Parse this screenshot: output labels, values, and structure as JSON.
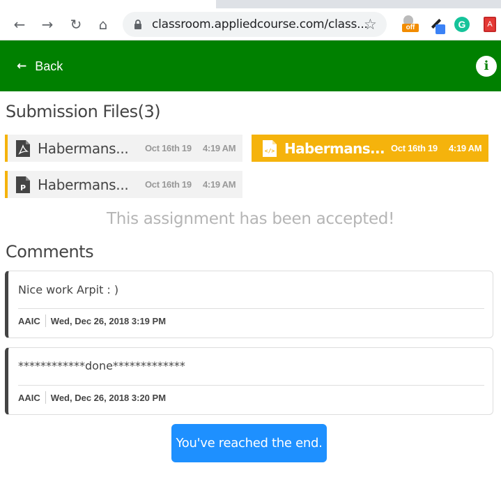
{
  "browser": {
    "url": "classroom.appliedcourse.com/class...",
    "nav": {
      "back_icon": "←",
      "forward_icon": "→",
      "reload_icon": "↻",
      "home_icon": "⌂",
      "star_icon": "☆"
    },
    "extensions": [
      {
        "name": "off-extension",
        "badge": "off"
      },
      {
        "name": "color-picker-extension"
      },
      {
        "name": "grammarly-extension",
        "letter": "G"
      },
      {
        "name": "red-extension",
        "letter": "A"
      }
    ]
  },
  "header": {
    "back_label": "Back",
    "back_icon": "←",
    "info_icon": "i",
    "bg_color": "#008000"
  },
  "submission": {
    "title": "Submission Files(3)",
    "files": [
      {
        "name": "Habermans...",
        "date": "Oct 16th 19",
        "time": "4:19 AM",
        "icon": "pdf-icon",
        "active": false
      },
      {
        "name": "Habermans...",
        "date": "Oct 16th 19",
        "time": "4:19 AM",
        "icon": "code-file-icon",
        "active": true
      },
      {
        "name": "Habermans...",
        "date": "Oct 16th 19",
        "time": "4:19 AM",
        "icon": "python-file-icon",
        "active": false
      }
    ],
    "accent_color": "#f5b30c",
    "status": "This assignment has been accepted!"
  },
  "comments": {
    "title": "Comments",
    "items": [
      {
        "text": "Nice work Arpit : )",
        "author": "AAIC",
        "timestamp": "Wed, Dec 26, 2018 3:19 PM"
      },
      {
        "text": "************done*************",
        "author": "AAIC",
        "timestamp": "Wed, Dec 26, 2018 3:20 PM"
      }
    ]
  },
  "end_label": "You've reached the end.",
  "end_color": "#1e90ff"
}
